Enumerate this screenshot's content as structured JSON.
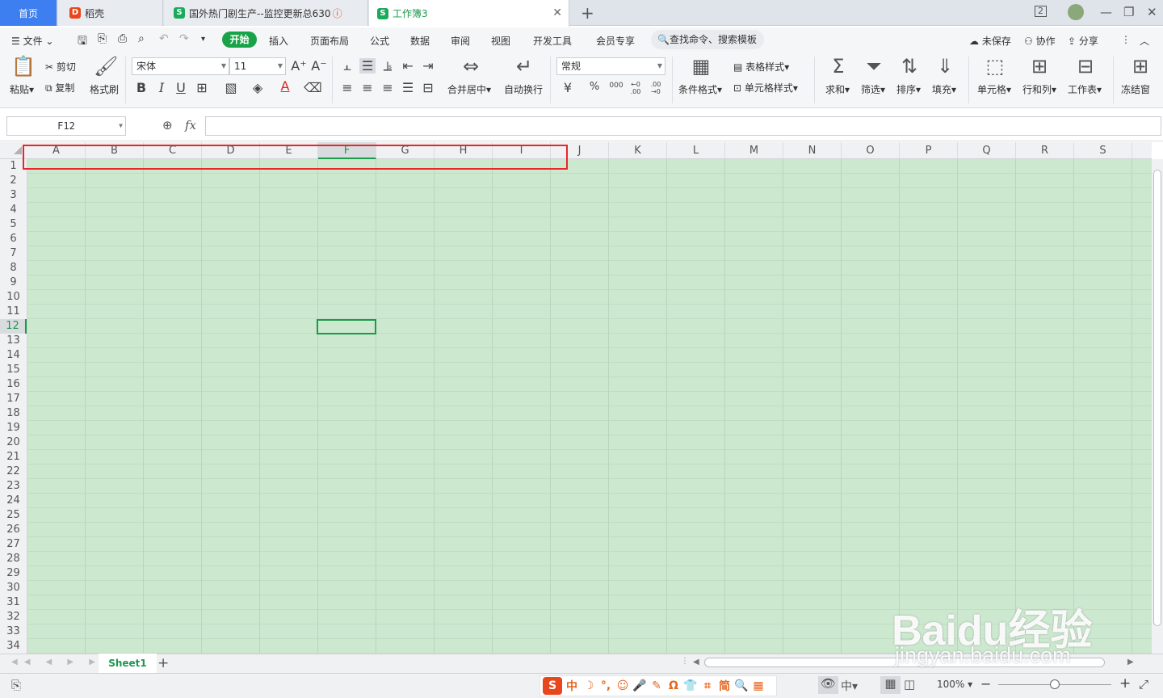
{
  "tabs": {
    "home": "首页",
    "daoke": "稻壳",
    "doc2": "国外热门剧生产--监控更新总630",
    "active": "工作簿3",
    "add": "+"
  },
  "window": {
    "badge": "2",
    "minimize": "—",
    "restore": "❐",
    "close": "✕"
  },
  "menu": {
    "file": "文件",
    "items": [
      "插入",
      "页面布局",
      "公式",
      "数据",
      "审阅",
      "视图",
      "开发工具",
      "会员专享"
    ],
    "active": "开始",
    "search": "查找命令、搜索模板",
    "unsaved": "未保存",
    "collab": "协作",
    "share": "分享"
  },
  "ribbon": {
    "paste": "粘贴",
    "cut": "剪切",
    "copy": "复制",
    "format_painter": "格式刷",
    "font_name": "宋体",
    "font_size": "11",
    "merge_center": "合并居中",
    "wrap_text": "自动换行",
    "number_format": "常规",
    "cond_format": "条件格式",
    "table_style": "表格样式",
    "cell_style": "单元格样式",
    "sum": "求和",
    "filter": "筛选",
    "sort": "排序",
    "fill": "填充",
    "cell": "单元格",
    "row_col": "行和列",
    "worksheet": "工作表",
    "freeze": "冻结窗",
    "currency": "¥",
    "percent": "%",
    "thousands": "000",
    "dec_inc": "←0 .00",
    "dec_dec": ".00 →0"
  },
  "formula_bar": {
    "name_box": "F12",
    "fx": "fx",
    "value": ""
  },
  "grid": {
    "columns": [
      "A",
      "B",
      "C",
      "D",
      "E",
      "F",
      "G",
      "H",
      "I",
      "J",
      "K",
      "L",
      "M",
      "N",
      "O",
      "P",
      "Q",
      "R",
      "S"
    ],
    "rows": [
      "1",
      "2",
      "3",
      "4",
      "5",
      "6",
      "7",
      "8",
      "9",
      "10",
      "11",
      "12",
      "13",
      "14",
      "15",
      "16",
      "17",
      "18",
      "19",
      "20",
      "21",
      "22",
      "23",
      "24",
      "25",
      "26",
      "27",
      "28",
      "29",
      "30",
      "31",
      "32",
      "33",
      "34"
    ],
    "selected_col": "F",
    "selected_row": "12"
  },
  "sheets": {
    "active": "Sheet1",
    "add": "+"
  },
  "status": {
    "zoom": "100%",
    "zoom_minus": "−",
    "zoom_plus": "+"
  },
  "ime": [
    "S",
    "中",
    "☽",
    "°,",
    "☺",
    "🎤",
    "✎",
    "Ω",
    "👕",
    "⌗",
    "简",
    "🔍",
    "▦"
  ],
  "watermark": {
    "brand": "Baidu经验",
    "url": "jingyan.baidu.com"
  },
  "colors": {
    "accent": "#1a9a4c",
    "tab_blue": "#3d7ff0",
    "grid_bg": "#cce8cf",
    "highlight": "#e8262a"
  }
}
